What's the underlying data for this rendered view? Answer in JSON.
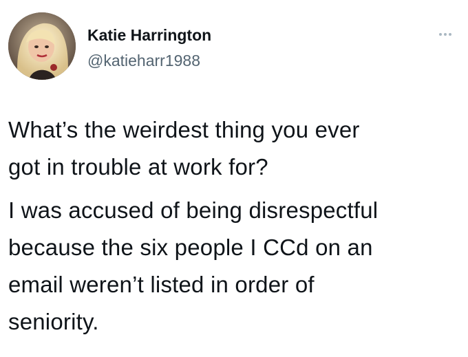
{
  "tweet": {
    "author_name": "Katie Harrington",
    "author_handle": "@katieharr1988",
    "more_icon": "more-horizontal-icon",
    "paragraph1": [
      "What’s the weirdest thing you ever",
      "got in trouble at work for?"
    ],
    "paragraph2": [
      "I was accused of being disrespectful",
      "because the six people I CCd on an",
      "email weren’t listed in order of",
      "seniority."
    ]
  },
  "colors": {
    "text": "#0f1419",
    "handle": "#536471",
    "more_dots": "#aab8c2"
  }
}
